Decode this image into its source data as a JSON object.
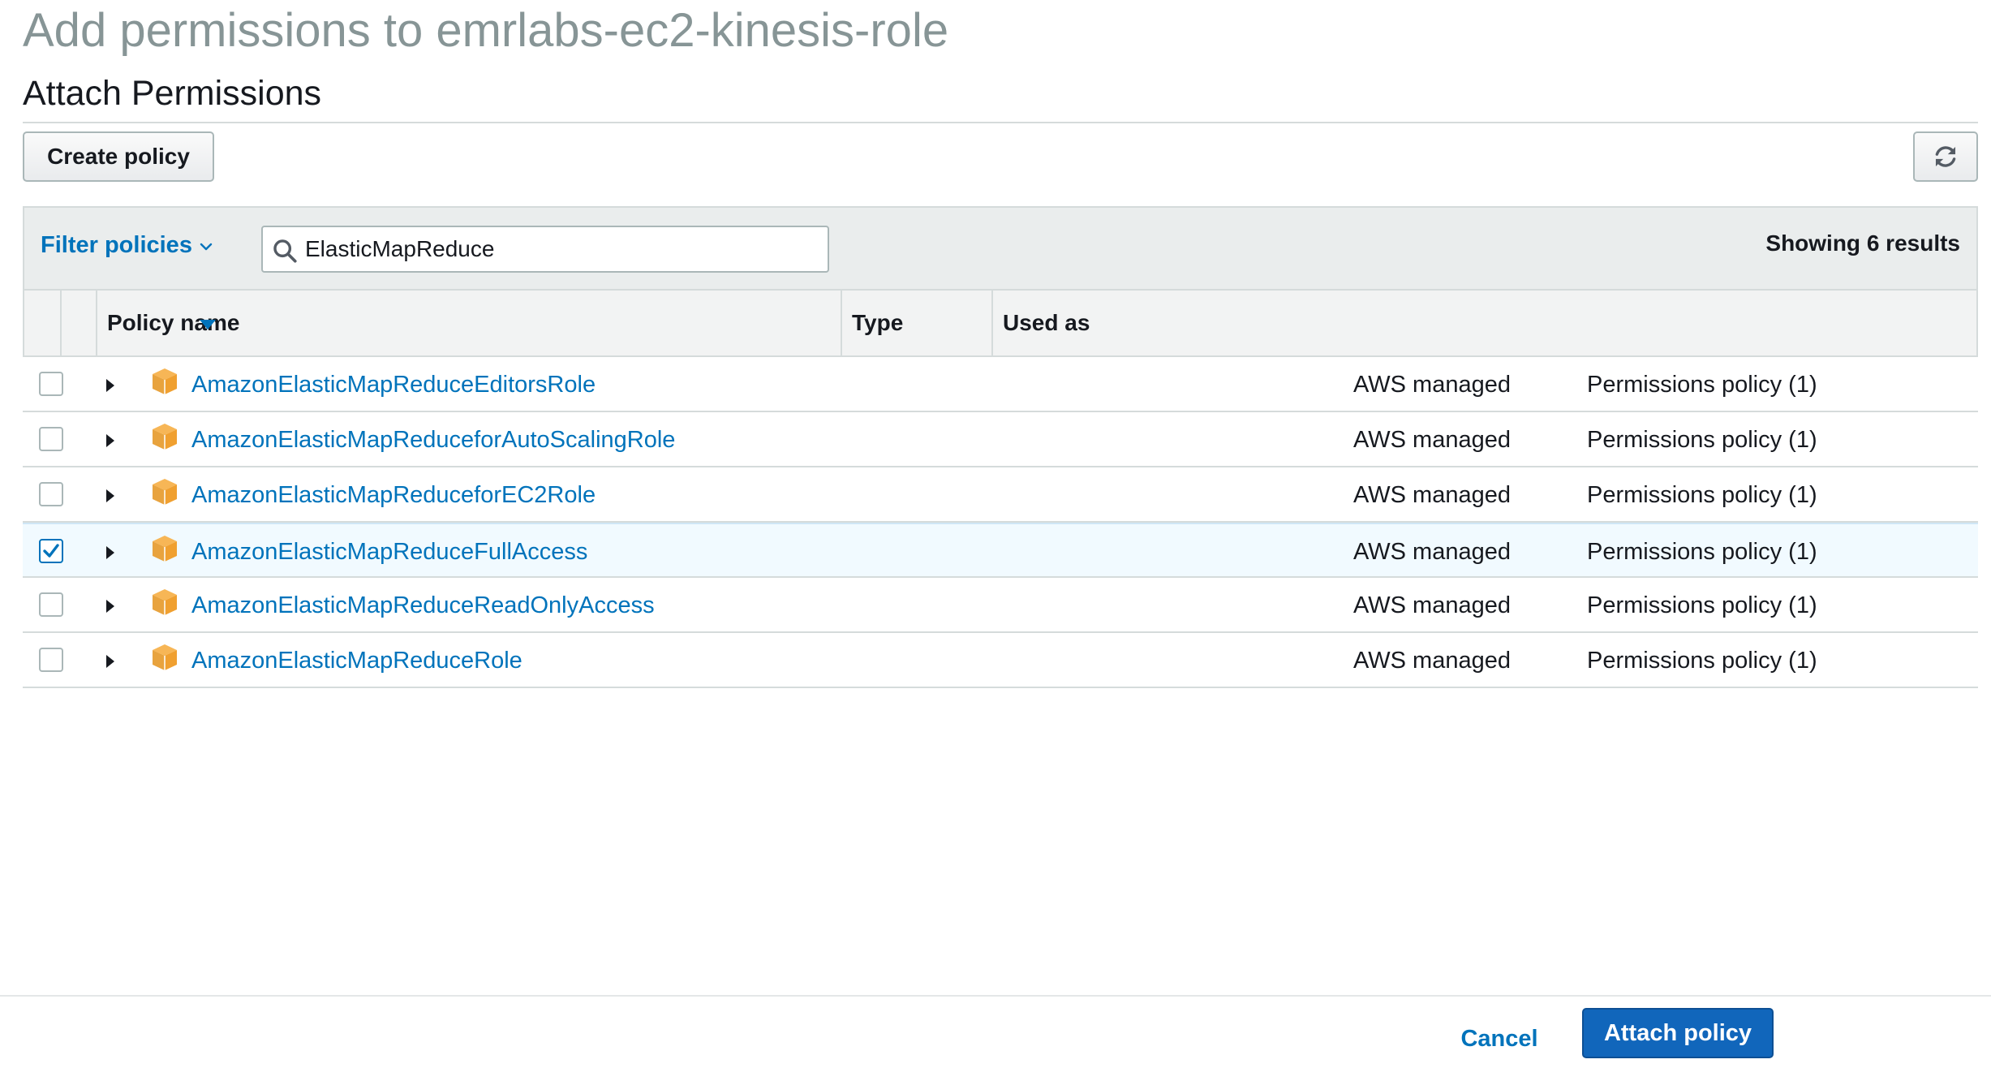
{
  "page": {
    "title": "Add permissions to emrlabs-ec2-kinesis-role",
    "section_title": "Attach Permissions"
  },
  "toolbar": {
    "create_policy_label": "Create policy",
    "refresh_icon": "refresh-icon"
  },
  "filter": {
    "label": "Filter policies",
    "search_value": "ElasticMapReduce",
    "results_text": "Showing 6 results"
  },
  "table": {
    "columns": {
      "policy_name": "Policy name",
      "type": "Type",
      "used_as": "Used as"
    },
    "rows": [
      {
        "name": "AmazonElasticMapReduceEditorsRole",
        "type": "AWS managed",
        "used_as": "Permissions policy (1)",
        "checked": false
      },
      {
        "name": "AmazonElasticMapReduceforAutoScalingRole",
        "type": "AWS managed",
        "used_as": "Permissions policy (1)",
        "checked": false
      },
      {
        "name": "AmazonElasticMapReduceforEC2Role",
        "type": "AWS managed",
        "used_as": "Permissions policy (1)",
        "checked": false
      },
      {
        "name": "AmazonElasticMapReduceFullAccess",
        "type": "AWS managed",
        "used_as": "Permissions policy (1)",
        "checked": true
      },
      {
        "name": "AmazonElasticMapReduceReadOnlyAccess",
        "type": "AWS managed",
        "used_as": "Permissions policy (1)",
        "checked": false
      },
      {
        "name": "AmazonElasticMapReduceRole",
        "type": "AWS managed",
        "used_as": "Permissions policy (1)",
        "checked": false
      }
    ]
  },
  "footer": {
    "cancel_label": "Cancel",
    "attach_label": "Attach policy"
  },
  "colors": {
    "link": "#0073bb",
    "primary_button": "#1166bb",
    "policy_icon": "#f0a030",
    "selected_row": "#f1faff"
  }
}
